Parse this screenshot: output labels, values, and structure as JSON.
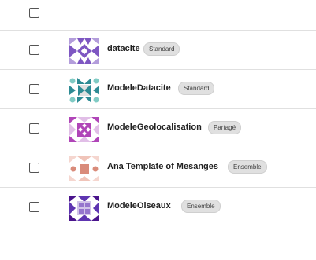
{
  "rows": [
    {
      "name": "datacite",
      "badge": "Standard"
    },
    {
      "name": "ModeleDatacite",
      "badge": "Standard"
    },
    {
      "name": "ModeleGeolocalisation",
      "badge": "Partagé"
    },
    {
      "name": "Ana Template of Mesanges",
      "badge": "Ensemble"
    },
    {
      "name": "ModeleOiseaux",
      "badge": "Ensemble"
    }
  ],
  "colors": {
    "avatar_purple": "#7e57c2",
    "avatar_teal": "#2e8b94",
    "avatar_magenta": "#b045b8",
    "avatar_salmon": "#d98b7a",
    "avatar_lavender": "#9575cd"
  },
  "icons": {
    "row_avatar": "identicon-avatar"
  }
}
